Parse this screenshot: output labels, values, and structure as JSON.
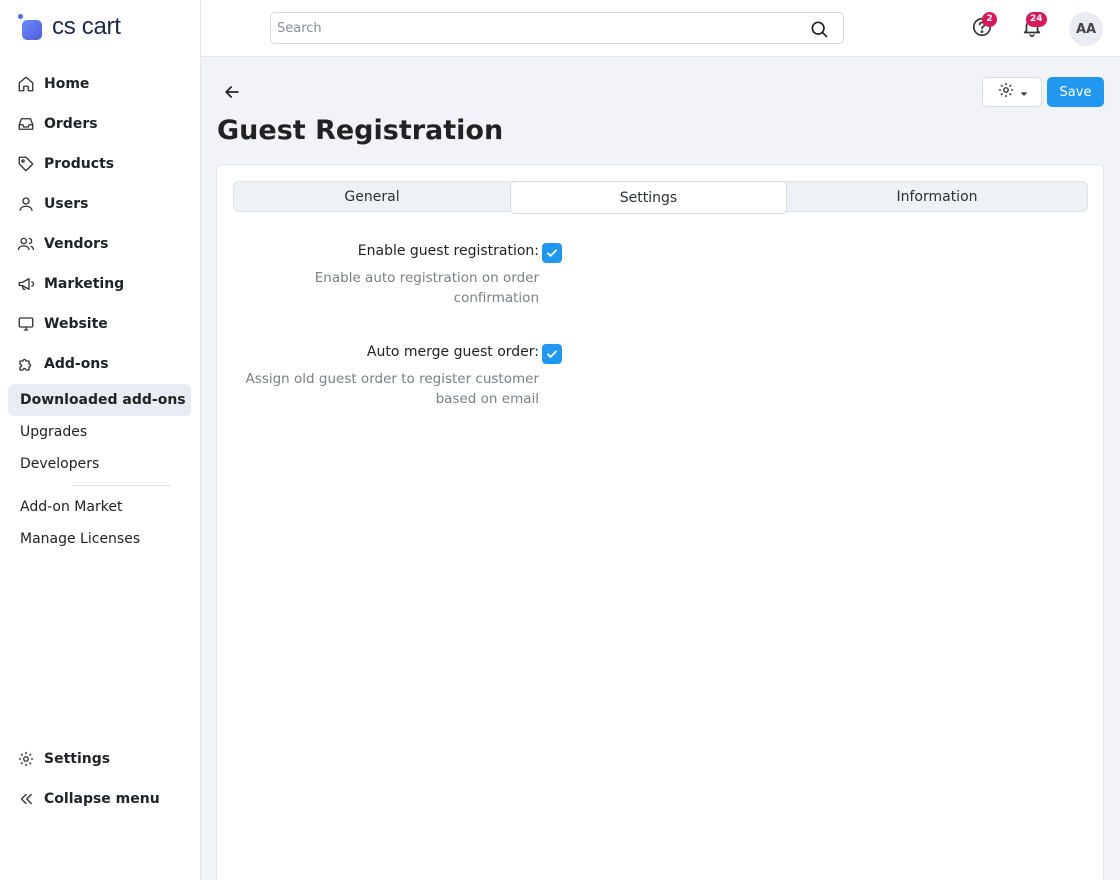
{
  "brand": {
    "name": "cs cart"
  },
  "sidebar": {
    "items": [
      {
        "label": "Home",
        "icon": "home-icon"
      },
      {
        "label": "Orders",
        "icon": "inbox-icon"
      },
      {
        "label": "Products",
        "icon": "tag-icon"
      },
      {
        "label": "Users",
        "icon": "user-icon"
      },
      {
        "label": "Vendors",
        "icon": "users-icon"
      },
      {
        "label": "Marketing",
        "icon": "megaphone-icon"
      },
      {
        "label": "Website",
        "icon": "monitor-icon"
      },
      {
        "label": "Add-ons",
        "icon": "puzzle-icon"
      }
    ],
    "sub_items": [
      "Downloaded add-ons",
      "Upgrades",
      "Developers"
    ],
    "sub_items_2": [
      "Add-on Market",
      "Manage Licenses"
    ],
    "active_sub_item": "Downloaded add-ons",
    "bottom": {
      "settings": "Settings",
      "collapse": "Collapse menu"
    }
  },
  "topbar": {
    "search_placeholder": "Search",
    "help_badge": "2",
    "notifications_badge": "24",
    "avatar_initials": "AA"
  },
  "page": {
    "title": "Guest Registration",
    "save_label": "Save"
  },
  "tabs": [
    {
      "label": "General",
      "active": false
    },
    {
      "label": "Settings",
      "active": true
    },
    {
      "label": "Information",
      "active": false
    }
  ],
  "settings": [
    {
      "label": "Enable guest registration:",
      "description": "Enable auto registration on order confirmation",
      "checked": true
    },
    {
      "label": "Auto merge guest order:",
      "description": "Assign old guest order to register customer based on email",
      "checked": true
    }
  ],
  "colors": {
    "accent": "#2297f0",
    "badge": "#d6185d",
    "active_nav_bg": "#e8edf5"
  }
}
